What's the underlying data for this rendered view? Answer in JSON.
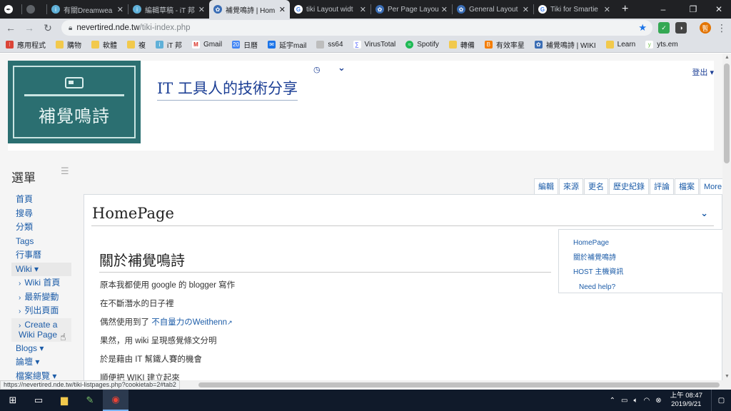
{
  "browser": {
    "tabs": [
      {
        "label": "",
        "favicon": "reaper-icon"
      },
      {
        "label": "",
        "favicon": "pinned-icon"
      },
      {
        "label": "有關Dreamwea",
        "favicon": "ithome-icon"
      },
      {
        "label": "編輯草稿 - iT 邦",
        "favicon": "ithome-icon"
      },
      {
        "label": "補覺鳴詩 | Hom",
        "favicon": "tiki-icon",
        "active": true
      },
      {
        "label": "tiki Layout widt",
        "favicon": "google-icon"
      },
      {
        "label": "Per Page Layou",
        "favicon": "tiki-icon"
      },
      {
        "label": "General Layout",
        "favicon": "tiki-icon"
      },
      {
        "label": "Tiki for Smartie",
        "favicon": "google-icon"
      }
    ],
    "new_tab": "+",
    "window_controls": {
      "minimize": "–",
      "restore": "❐",
      "close": "✕"
    },
    "url_host": "nevertired.nde.tw",
    "url_path": "/tiki-index.php",
    "bookmarks": [
      {
        "label": "應用程式",
        "icon": "apps-icon"
      },
      {
        "label": "購物",
        "icon": "folder-icon"
      },
      {
        "label": "軟體",
        "icon": "folder-icon"
      },
      {
        "label": "複",
        "icon": "folder-icon"
      },
      {
        "label": "iT 邦",
        "icon": "ithome-icon"
      },
      {
        "label": "Gmail",
        "icon": "gmail-icon"
      },
      {
        "label": "日曆",
        "icon": "calendar-icon"
      },
      {
        "label": "延宇mail",
        "icon": "mail-icon"
      },
      {
        "label": "ss64",
        "icon": "page-icon"
      },
      {
        "label": "VirusTotal",
        "icon": "virustotal-icon"
      },
      {
        "label": "Spotify",
        "icon": "spotify-icon"
      },
      {
        "label": "轉備",
        "icon": "folder-icon"
      },
      {
        "label": "有效率星",
        "icon": "blogger-icon"
      },
      {
        "label": "補覺鳴詩 | WIKI",
        "icon": "tiki-icon"
      },
      {
        "label": "Learn",
        "icon": "folder-icon"
      },
      {
        "label": "yts.em",
        "icon": "yts-icon"
      }
    ],
    "status_url": "https://nevertired.nde.tw/tiki-listpages.php?cookietab=2#tab2"
  },
  "site": {
    "logo_text": "補覺鳴詩",
    "title": "IT 工具人的技術分享",
    "logout": "登出 ▾"
  },
  "sidebar": {
    "title": "選單",
    "items": [
      "首頁",
      "搜尋",
      "分類",
      "Tags",
      "行事曆"
    ],
    "wiki": "Wiki ▾",
    "wiki_sub": [
      "Wiki 首頁",
      "最新變動",
      "列出頁面",
      "Create a Wiki Page"
    ],
    "more": [
      "Blogs ▾",
      "論壇 ▾",
      "檔案總覽 ▾"
    ]
  },
  "page": {
    "actions": [
      "編輯",
      "來源",
      "更名",
      "歷史紀錄",
      "評論",
      "檔案",
      "More ▾"
    ],
    "title": "HomePage",
    "toc": [
      "HomePage",
      "關於補覺鳴詩",
      "HOST 主機資訊",
      "Need help?"
    ],
    "heading": "關於補覺鳴詩",
    "paras": [
      "原本我都使用 google 的 blogger 寫作",
      "在不斷潛水的日子裡",
      "偶然使用到了 ",
      "果然，用 wiki 呈現感覺條文分明",
      "於是藉由 IT 幫鐵人賽的機會",
      "順便把 WIKI 建立起來"
    ],
    "weithenn_link": "不自量力のWeithenn"
  },
  "taskbar": {
    "time": "上午 08:47",
    "date": "2019/9/21"
  },
  "colors": {
    "link": "#1c5ca8",
    "logo_bg": "#2b6f71",
    "tab_strip": "#202124"
  }
}
